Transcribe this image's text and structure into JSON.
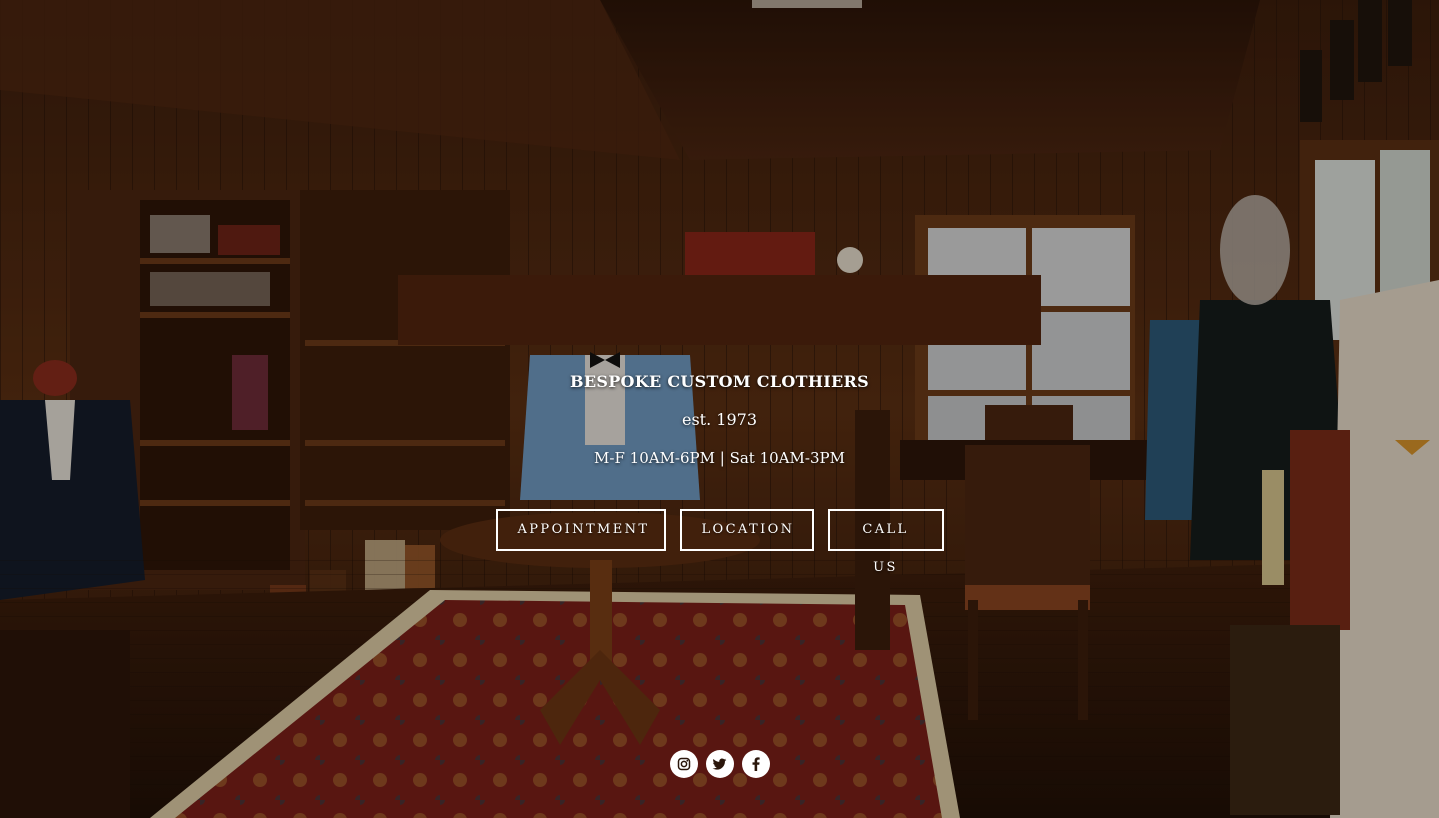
{
  "hero": {
    "business_name": "BESPOKE CUSTOM CLOTHIERS",
    "established": "est. 1973",
    "hours": "M-F 10AM-6PM | Sat 10AM-3PM"
  },
  "buttons": {
    "appointment": "APPOINTMENT",
    "location": "LOCATION",
    "call": "CALL US"
  },
  "social": {
    "icons": [
      "instagram-icon",
      "twitter-icon",
      "facebook-icon"
    ]
  },
  "colors": {
    "logo_block": "#3b1a0a",
    "button_border": "#ffffff",
    "text": "#ffffff",
    "social_bg": "#ffffff",
    "social_icon": "#2a160b"
  }
}
